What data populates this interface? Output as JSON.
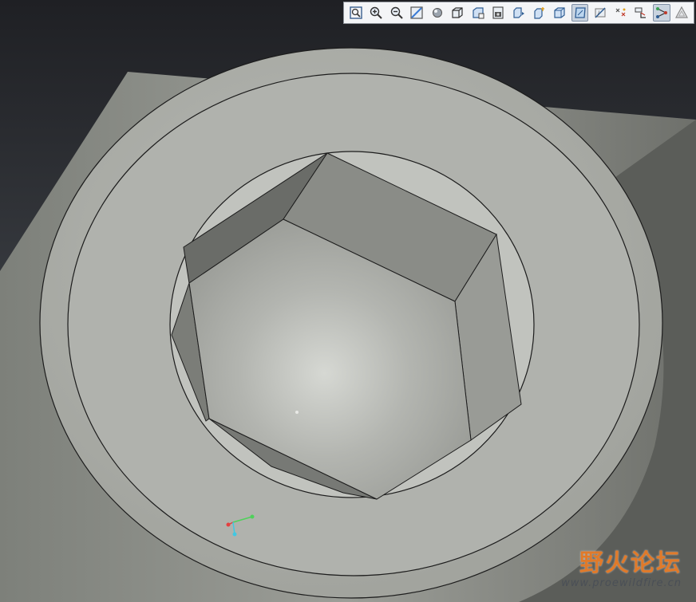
{
  "toolbar": {
    "buttons": [
      {
        "icon": "refit-icon",
        "active": false
      },
      {
        "icon": "zoom-in-icon",
        "active": false
      },
      {
        "icon": "zoom-out-icon",
        "active": false
      },
      {
        "icon": "repaint-icon",
        "active": false
      },
      {
        "icon": "shading-icon",
        "active": false
      },
      {
        "icon": "saved-views-icon",
        "active": false
      },
      {
        "icon": "view-manager-icon",
        "active": false
      },
      {
        "icon": "display-style-icon",
        "active": false
      },
      {
        "icon": "annotation-display-icon",
        "active": false
      },
      {
        "icon": "spin-center-icon",
        "active": false
      },
      {
        "icon": "no-hidden-icon",
        "active": false
      },
      {
        "icon": "shaded-with-edges-icon",
        "active": true
      },
      {
        "icon": "plane-display-icon",
        "active": false
      },
      {
        "icon": "point-display-icon",
        "active": false
      },
      {
        "icon": "csys-display-icon",
        "active": false
      },
      {
        "icon": "axis-display-icon",
        "active": true
      },
      {
        "icon": "triangle-display-icon",
        "active": false
      }
    ]
  },
  "watermark": {
    "title": "野火论坛",
    "url": "www.proewildfire.cn",
    "colors": {
      "title": "#e07a2a",
      "url": "#4a4f56"
    }
  },
  "scene": {
    "object": "socket-head-cap-screw-hex-recess",
    "colors": {
      "part": "#a9aba6",
      "part_dark": "#5d5f5b",
      "edge": "#1a1a1a"
    }
  }
}
